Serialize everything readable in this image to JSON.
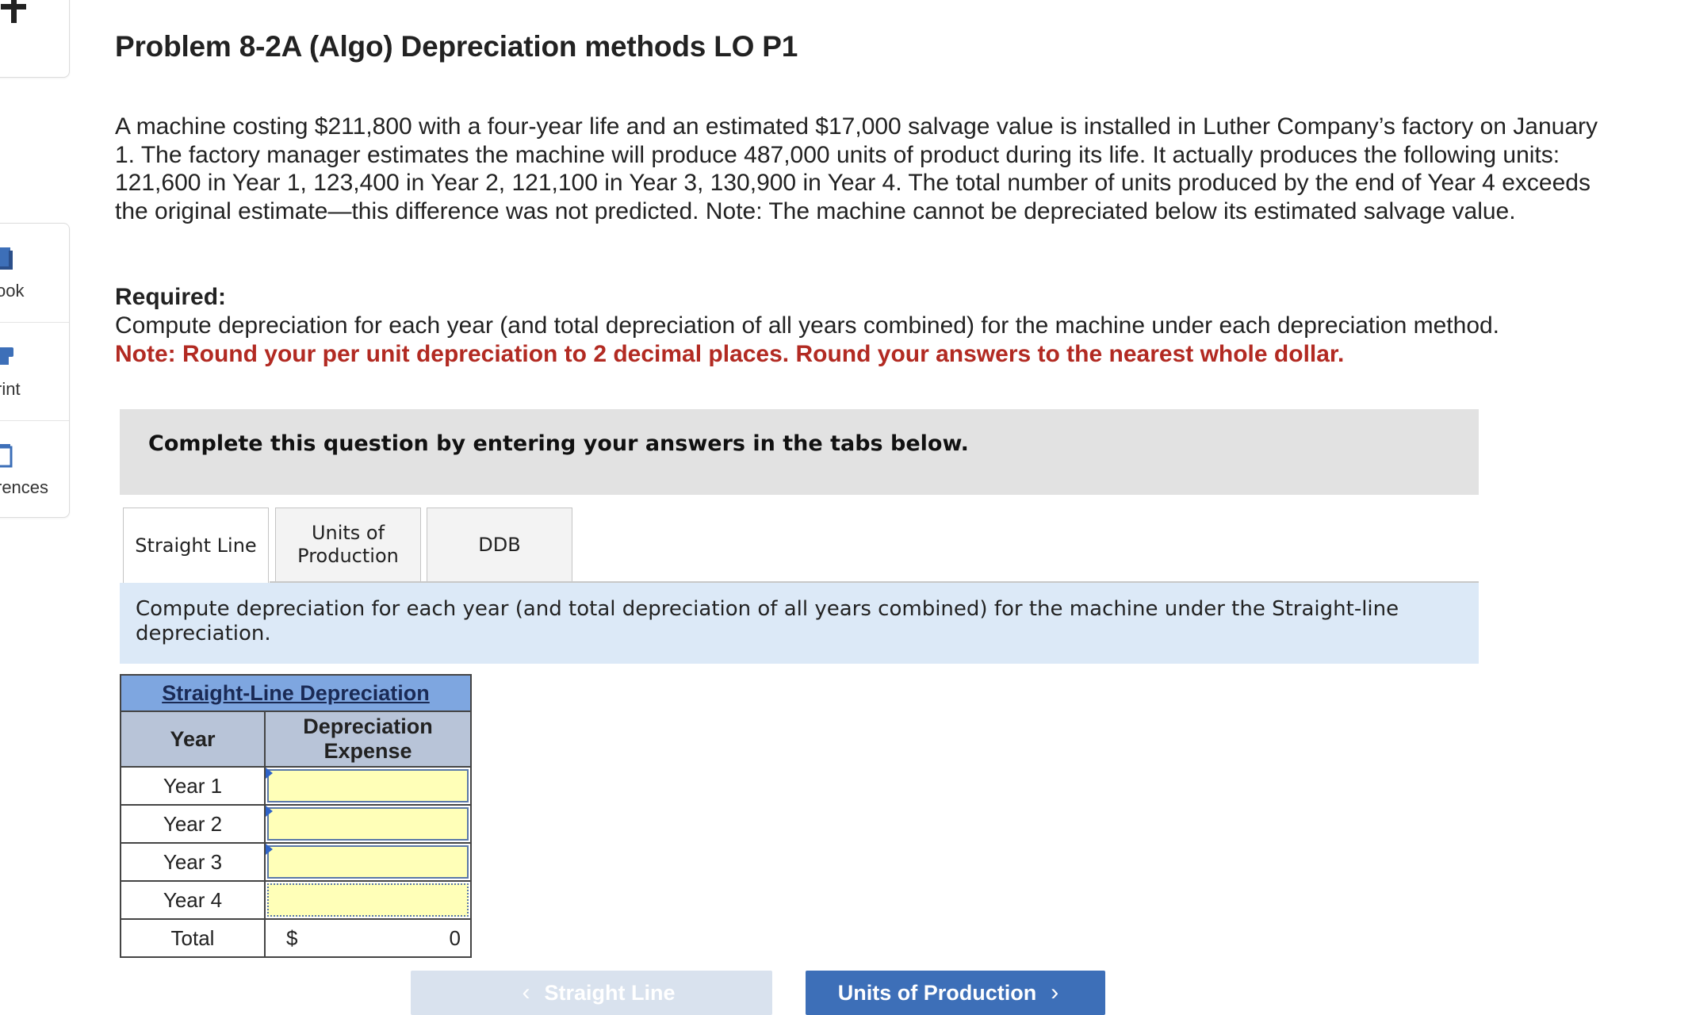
{
  "sidebar": {
    "items": [
      {
        "label": "ook",
        "icon": "ebook-icon"
      },
      {
        "label": "rint",
        "icon": "print-icon"
      },
      {
        "label": "rences",
        "icon": "references-icon"
      }
    ]
  },
  "problem": {
    "title": "Problem 8-2A (Algo) Depreciation methods LO P1",
    "intro": "A machine costing $211,800 with a four-year life and an estimated $17,000 salvage value is installed in Luther Company’s factory on January 1. The factory manager estimates the machine will produce 487,000 units of product during its life. It actually produces the following units: 121,600 in Year 1, 123,400 in Year 2, 121,100 in Year 3, 130,900 in Year 4. The total number of units produced by the end of Year 4 exceeds the original estimate—this difference was not predicted. Note: The machine cannot be depreciated below its estimated salvage value.",
    "required_label": "Required:",
    "required_text": "Compute depreciation for each year (and total depreciation of all years combined) for the machine under each depreciation method.",
    "required_note": "Note: Round your per unit depreciation to 2 decimal places. Round your answers to the nearest whole dollar."
  },
  "complete_box": {
    "text": "Complete this question by entering your answers in the tabs below."
  },
  "tabs": [
    {
      "label": "Straight Line",
      "active": true
    },
    {
      "label": "Units of Production",
      "active": false
    },
    {
      "label": "DDB",
      "active": false
    }
  ],
  "instruction": "Compute depreciation for each year (and total depreciation of all years combined) for the machine under the Straight-line depreciation.",
  "table": {
    "title": "Straight-Line Depreciation",
    "col_year": "Year",
    "col_expense": "Depreciation Expense",
    "rows": [
      {
        "year": "Year 1",
        "value": ""
      },
      {
        "year": "Year 2",
        "value": ""
      },
      {
        "year": "Year 3",
        "value": ""
      },
      {
        "year": "Year 4",
        "value": ""
      }
    ],
    "total_label": "Total",
    "total_currency": "$",
    "total_value": "0"
  },
  "nav": {
    "prev_label": "Straight Line",
    "next_label": "Units of Production"
  },
  "colors": {
    "note_red": "#b22a22",
    "table_title_blue": "#7ea6e0",
    "input_yellow": "#ffffb8",
    "next_button_blue": "#3d6fb8"
  }
}
